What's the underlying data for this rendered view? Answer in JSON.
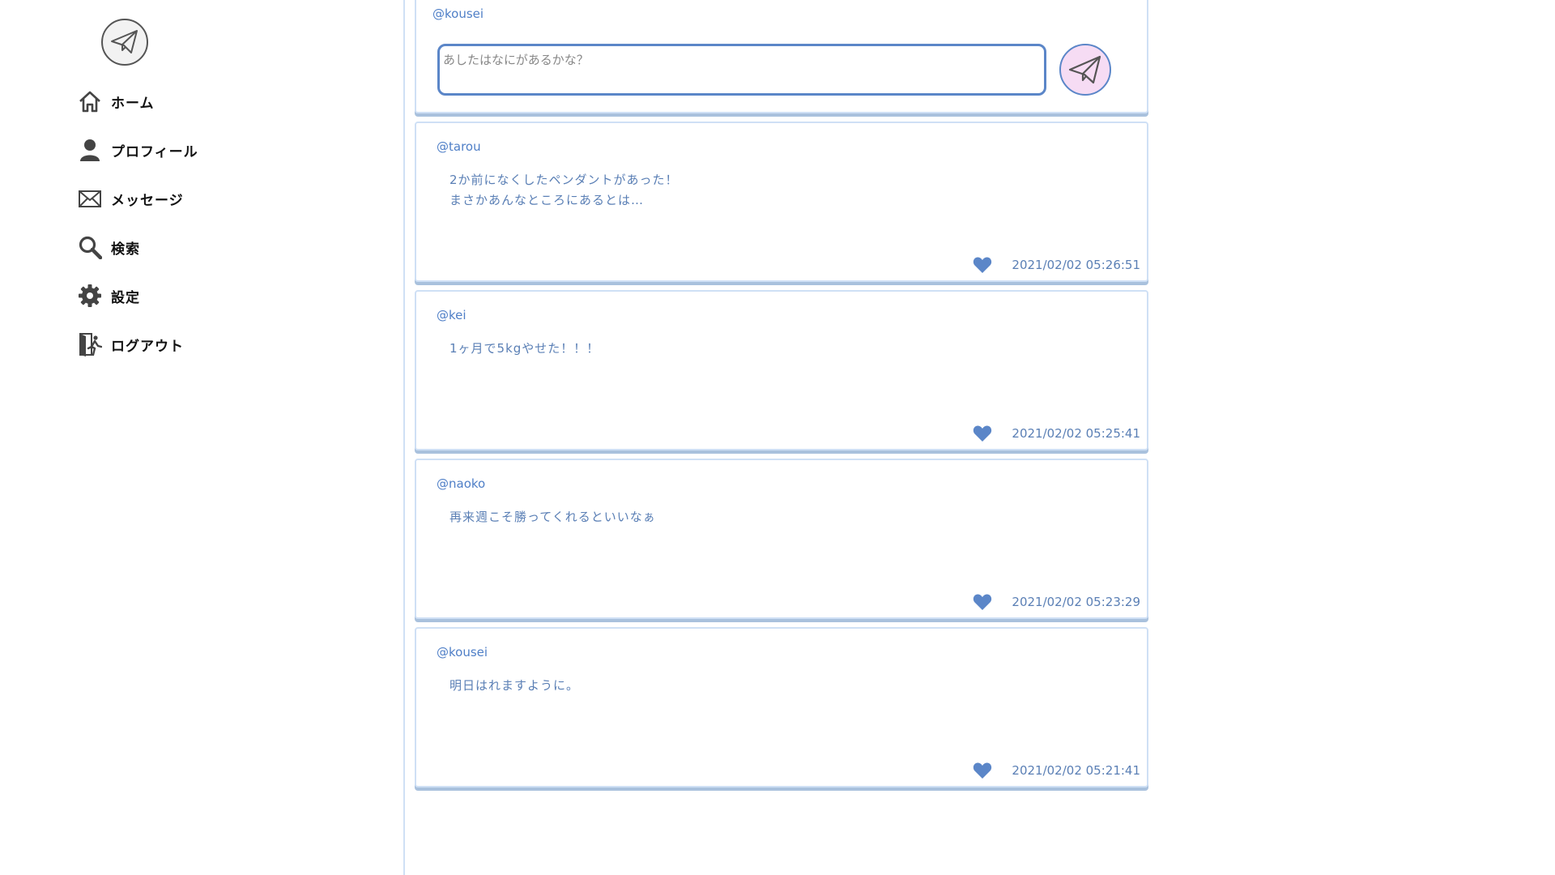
{
  "sidebar": {
    "logo_icon": "paper-plane-icon",
    "items": [
      {
        "label": "ホーム",
        "icon": "home-icon"
      },
      {
        "label": "プロフィール",
        "icon": "user-icon"
      },
      {
        "label": "メッセージ",
        "icon": "mail-icon"
      },
      {
        "label": "検索",
        "icon": "search-icon"
      },
      {
        "label": "設定",
        "icon": "gear-icon"
      },
      {
        "label": "ログアウト",
        "icon": "logout-icon"
      }
    ]
  },
  "composer": {
    "user": "@kousei",
    "placeholder": "あしたはなにがあるかな？",
    "send_icon": "paper-plane-icon"
  },
  "posts": [
    {
      "user": "@tarou",
      "body": "2か前になくしたペンダントがあった！\nまさかあんなところにあるとは…",
      "time": "2021/02/02 05:26:51"
    },
    {
      "user": "@kei",
      "body": "1ヶ月で5kgやせた！！！",
      "time": "2021/02/02 05:25:41"
    },
    {
      "user": "@naoko",
      "body": "再来週こそ勝ってくれるといいなぁ",
      "time": "2021/02/02 05:23:29"
    },
    {
      "user": "@kousei",
      "body": "明日はれますように。",
      "time": "2021/02/02 05:21:41"
    }
  ],
  "colors": {
    "accent": "#5b86c8",
    "text_blue": "#4f7fc7",
    "border": "#cfe0f5",
    "send_bg": "#f6dcf4"
  }
}
